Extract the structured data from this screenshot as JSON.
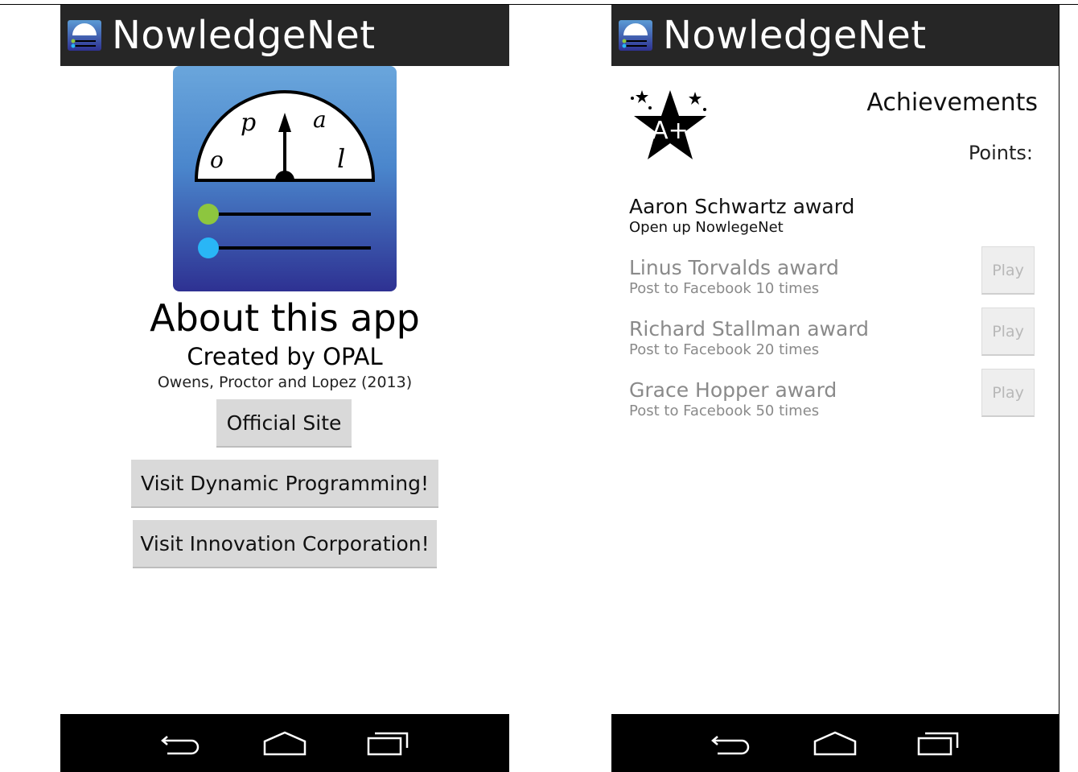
{
  "app": {
    "title": "NowledgeNet"
  },
  "about_screen": {
    "heading": "About this app",
    "created_by": "Created by OPAL",
    "authors": "Owens, Proctor and Lopez (2013)",
    "buttons": {
      "official_site": "Official Site",
      "dynamic_programming": "Visit Dynamic Programming!",
      "innovation_corporation": "Visit Innovation Corporation!"
    },
    "logo_letters": [
      "o",
      "p",
      "a",
      "l"
    ]
  },
  "achievements_screen": {
    "heading": "Achievements",
    "points_label": "Points:",
    "icon_text": "A+",
    "awards": [
      {
        "name": "Aaron Schwartz award",
        "description": "Open up NowlegeNet",
        "unlocked": true
      },
      {
        "name": "Linus Torvalds award",
        "description": "Post to Facebook 10 times",
        "unlocked": false,
        "button": "Play"
      },
      {
        "name": "Richard Stallman award",
        "description": "Post to Facebook 20 times",
        "unlocked": false,
        "button": "Play"
      },
      {
        "name": "Grace Hopper award",
        "description": "Post to Facebook 50 times",
        "unlocked": false,
        "button": "Play"
      }
    ]
  },
  "colors": {
    "action_bar": "#262626",
    "nav_bar": "#000000",
    "logo_top": "#5b9bd5",
    "logo_bottom": "#2e3192",
    "dot_green": "#8dc63f",
    "dot_blue": "#29b6f6"
  }
}
